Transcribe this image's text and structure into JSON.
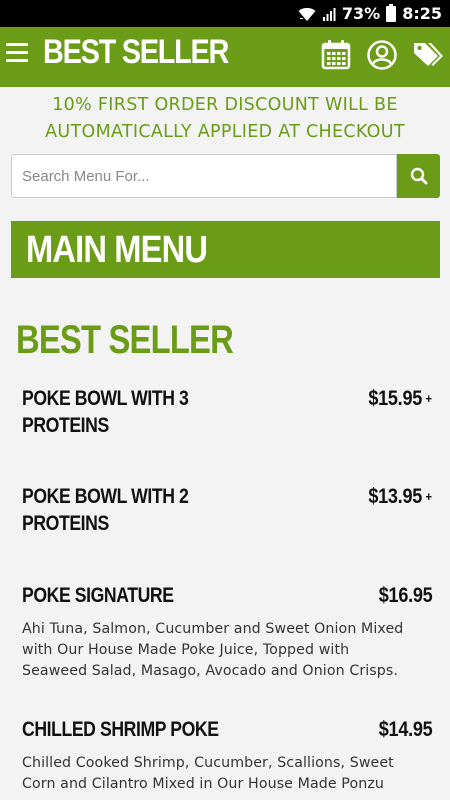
{
  "status_bar": {
    "battery": "73%",
    "time": "8:25"
  },
  "header": {
    "title": "BEST SELLER",
    "icons": [
      "menu-icon",
      "calendar-icon",
      "user-icon",
      "tag-icon"
    ]
  },
  "promo": {
    "line1": "10% FIRST ORDER DISCOUNT WILL BE",
    "line2": "AUTOMATICALLY APPLIED AT CHECKOUT"
  },
  "search": {
    "placeholder": "Search Menu For...",
    "value": ""
  },
  "menu_banner": {
    "title": "MAIN MENU"
  },
  "section": {
    "title": "BEST SELLER"
  },
  "items": [
    {
      "name_line1": "POKE BOWL WITH 3",
      "name_line2": "PROTEINS",
      "price": "$15.95",
      "plus": "+"
    },
    {
      "name_line1": "POKE BOWL WITH 2",
      "name_line2": "PROTEINS",
      "price": "$13.95",
      "plus": "+"
    },
    {
      "name_line1": "POKE SIGNATURE",
      "price": "$16.95",
      "desc_line1": "Ahi Tuna, Salmon, Cucumber and Sweet Onion Mixed",
      "desc_line2": "with Our House Made Poke Juice, Topped with",
      "desc_line3": "Seaweed Salad, Masago, Avocado and Onion Crisps."
    },
    {
      "name_line1": "CHILLED SHRIMP POKE",
      "price": "$14.95",
      "desc_line1": "Chilled Cooked Shrimp, Cucumber, Scallions, Sweet",
      "desc_line2": "Corn and Cilantro Mixed in Our House Made Ponzu"
    }
  ],
  "colors": {
    "brand_green": "#6b9c17",
    "background": "#f3f3f3"
  }
}
